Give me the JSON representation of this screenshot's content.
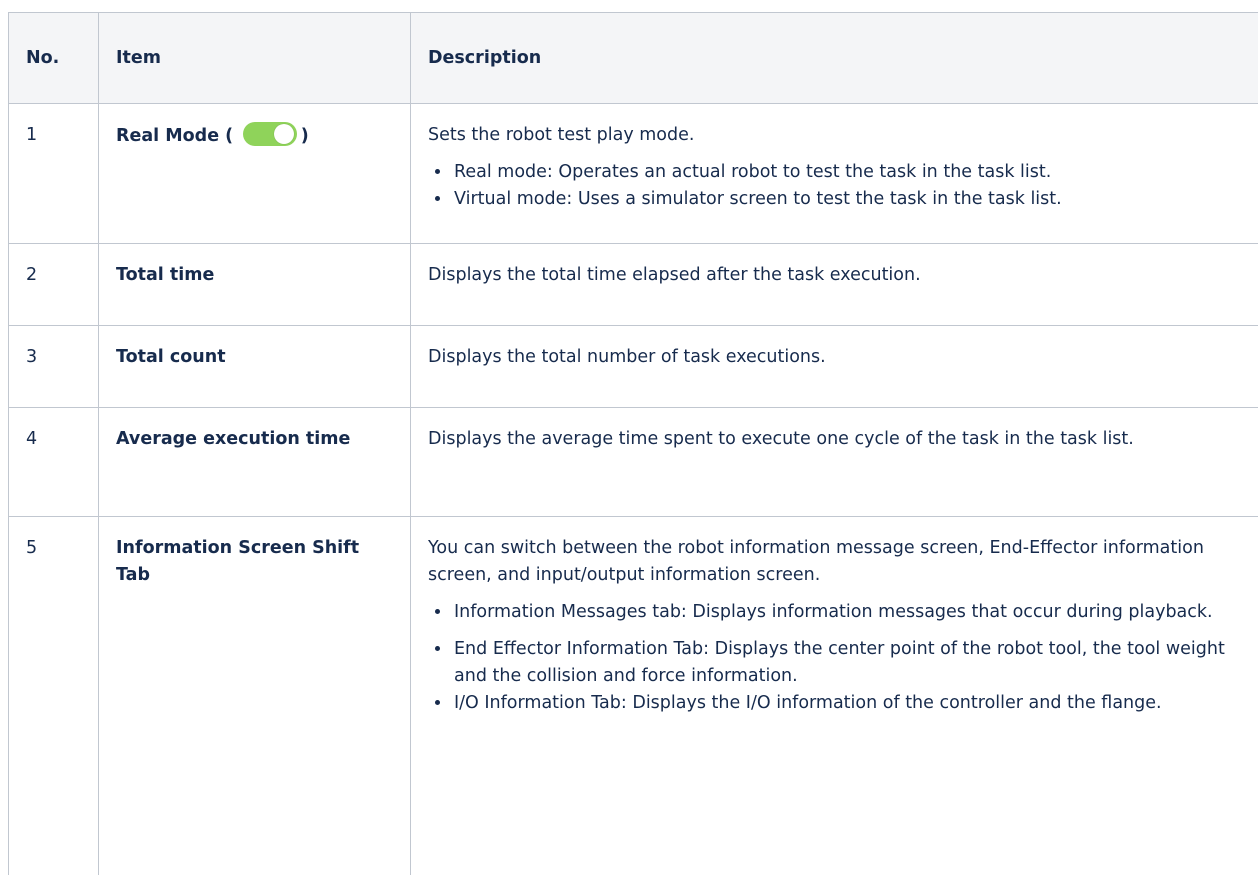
{
  "table": {
    "headers": {
      "no": "No.",
      "item": "Item",
      "description": "Description"
    },
    "rows": [
      {
        "no": "1",
        "item_prefix": "Real Mode (",
        "item_suffix": ")",
        "toggle": {
          "state": "on",
          "color": "#8fd35a"
        },
        "description": "Sets the robot test play mode.",
        "bullets": [
          "Real mode: Operates an actual robot to test the task in the task list.",
          "Virtual mode: Uses a simulator screen to test the task in the task list."
        ]
      },
      {
        "no": "2",
        "item": "Total time",
        "description": "Displays the total time elapsed after the task execution."
      },
      {
        "no": "3",
        "item": "Total count",
        "description": "Displays the total number of task executions."
      },
      {
        "no": "4",
        "item": "Average execution time",
        "description": "Displays the average time spent to execute one cycle of the task in the task list."
      },
      {
        "no": "5",
        "item": "Information Screen Shift Tab",
        "description": "You can switch between the robot information message screen, End-Effector information screen, and input/output information screen.",
        "bullets": [
          "Information Messages tab: Displays information messages that occur during playback.",
          "End Effector Information Tab: Displays the center point of the robot tool, the tool weight and the collision and force information.",
          "I/O Information Tab: Displays the I/O information of the controller and the flange."
        ]
      }
    ]
  }
}
